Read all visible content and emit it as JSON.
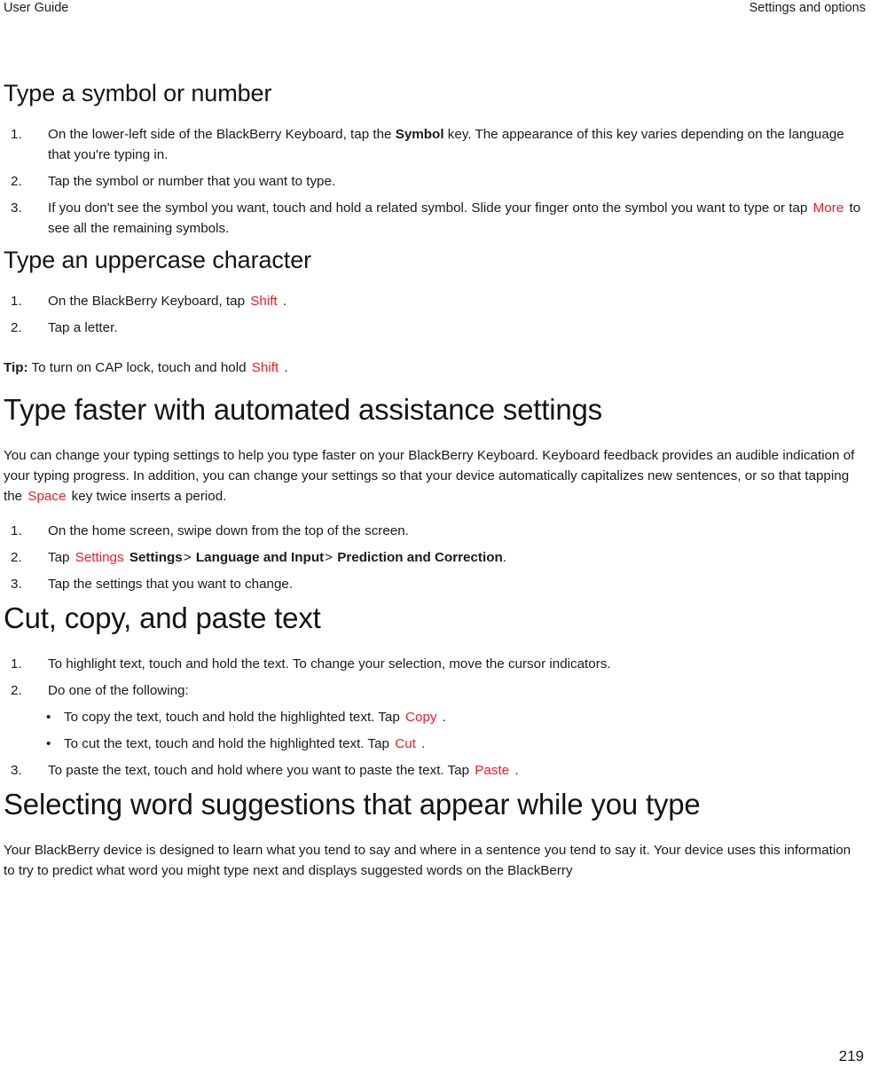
{
  "header": {
    "left": "User Guide",
    "right": "Settings and options"
  },
  "colors": {
    "ui_key_red": "#ee1c25",
    "text": "#1a1a1a",
    "background": "#ffffff"
  },
  "sections": [
    {
      "id": "type-a-symbol-or-number",
      "level": "h2",
      "title": "Type a symbol or number",
      "steps": [
        {
          "runs": [
            {
              "type": "text",
              "text": "On the lower-left side of the BlackBerry Keyboard, tap the "
            },
            {
              "type": "bold",
              "text": "Symbol"
            },
            {
              "type": "text",
              "text": " key. The appearance of this key varies depending on the language that you're typing in."
            }
          ]
        },
        {
          "runs": [
            {
              "type": "text",
              "text": "Tap the symbol or number that you want to type."
            }
          ]
        },
        {
          "runs": [
            {
              "type": "text",
              "text": "If you don't see the symbol you want, touch and hold a related symbol. Slide your finger onto the symbol you want to type or tap "
            },
            {
              "type": "key",
              "text": "More"
            },
            {
              "type": "text",
              "text": " to see all the remaining symbols."
            }
          ]
        }
      ]
    },
    {
      "id": "type-an-uppercase-character",
      "level": "h2",
      "title": "Type an uppercase character",
      "steps": [
        {
          "runs": [
            {
              "type": "text",
              "text": "On the BlackBerry Keyboard, tap "
            },
            {
              "type": "key",
              "text": "Shift"
            },
            {
              "type": "text",
              "text": "."
            }
          ]
        },
        {
          "runs": [
            {
              "type": "text",
              "text": "Tap a letter."
            }
          ]
        }
      ],
      "tip": {
        "runs": [
          {
            "type": "bold",
            "text": "Tip:"
          },
          {
            "type": "text",
            "text": " To turn on CAP lock, touch and hold "
          },
          {
            "type": "key",
            "text": "Shift"
          },
          {
            "type": "text",
            "text": "."
          }
        ]
      }
    },
    {
      "id": "type-faster-with-automated-assistance-settings",
      "level": "h1",
      "title": "Type faster with automated assistance settings",
      "intro": {
        "runs": [
          {
            "type": "text",
            "text": "You can change your typing settings to help you type faster on your BlackBerry Keyboard. Keyboard feedback provides an audible indication of your typing progress. In addition, you can change your settings so that your device automatically capitalizes new sentences, or so that tapping the "
          },
          {
            "type": "key",
            "text": "Space"
          },
          {
            "type": "text",
            "text": " key twice inserts a period."
          }
        ]
      },
      "steps": [
        {
          "runs": [
            {
              "type": "text",
              "text": "On the home screen, swipe down from the top of the screen."
            }
          ]
        },
        {
          "runs": [
            {
              "type": "text",
              "text": "Tap "
            },
            {
              "type": "key",
              "text": "Settings"
            },
            {
              "type": "bold",
              "text": "Settings"
            },
            {
              "type": "sep",
              "text": ">"
            },
            {
              "type": "bold",
              "text": "Language and Input"
            },
            {
              "type": "sep",
              "text": ">"
            },
            {
              "type": "bold",
              "text": "Prediction and Correction"
            },
            {
              "type": "text",
              "text": "."
            }
          ]
        },
        {
          "runs": [
            {
              "type": "text",
              "text": "Tap the settings that you want to change."
            }
          ]
        }
      ]
    },
    {
      "id": "cut-copy-and-paste-text",
      "level": "h1",
      "title": "Cut, copy, and paste text",
      "steps": [
        {
          "runs": [
            {
              "type": "text",
              "text": "To highlight text, touch and hold the text. To change your selection, move the cursor indicators."
            }
          ]
        },
        {
          "runs": [
            {
              "type": "text",
              "text": "Do one of the following:"
            }
          ],
          "bullets": [
            {
              "runs": [
                {
                  "type": "text",
                  "text": "To copy the text, touch and hold the highlighted text. Tap "
                },
                {
                  "type": "key",
                  "text": "Copy"
                },
                {
                  "type": "text",
                  "text": "."
                }
              ]
            },
            {
              "runs": [
                {
                  "type": "text",
                  "text": "To cut the text, touch and hold the highlighted text. Tap "
                },
                {
                  "type": "key",
                  "text": "Cut"
                },
                {
                  "type": "text",
                  "text": "."
                }
              ]
            }
          ]
        },
        {
          "runs": [
            {
              "type": "text",
              "text": "To paste the text, touch and hold where you want to paste the text. Tap "
            },
            {
              "type": "key",
              "text": "Paste"
            },
            {
              "type": "text",
              "text": "."
            }
          ]
        }
      ]
    },
    {
      "id": "selecting-word-suggestions-that-appear-while-you-type",
      "level": "h1",
      "title": "Selecting word suggestions that appear while you type",
      "intro": {
        "runs": [
          {
            "type": "text",
            "text": "Your BlackBerry device is designed to learn what you tend to say and where in a sentence you tend to say it. Your device uses this information to try to predict what word you might type next and displays suggested words on the BlackBerry"
          }
        ]
      }
    }
  ],
  "footer": {
    "page_number": "219"
  }
}
